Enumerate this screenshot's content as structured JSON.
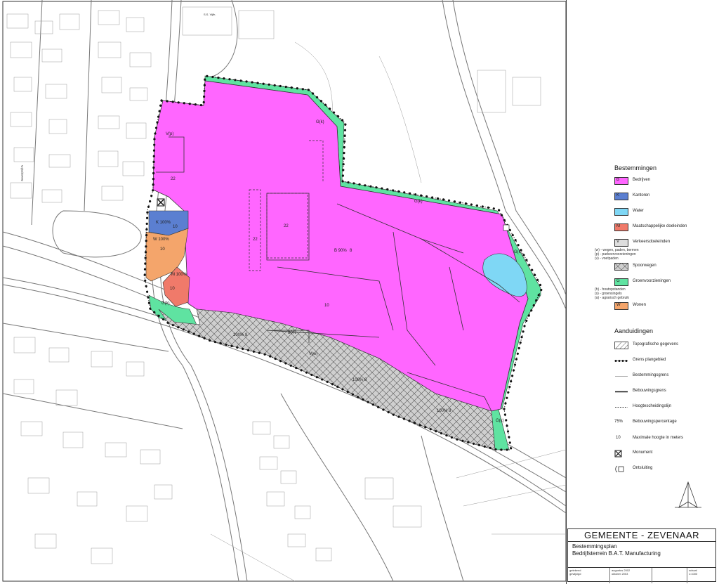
{
  "map": {
    "labels": {
      "gk_top": "G(k)",
      "gk_right": "G(k)",
      "gk_far_right": "G(k)",
      "gk_bottom_right": "G(k)",
      "gk_bottom_left": "G(k)",
      "vp_top_left": "V(p)",
      "height_22_left": "22",
      "height_22_mid1": "22",
      "height_22_mid2": "22",
      "height_10_center": "10",
      "b_90": "B  90%",
      "b_90_height": "8",
      "k_100": "K  100%",
      "k_height": "10",
      "w_100": "W 100%",
      "w_height": "10",
      "m_100": "M 100%",
      "m_height": "10",
      "rail_100_1": "100% 8",
      "rail_80": "80%",
      "rail_vw": "V(w)",
      "rail_100_2": "100% 8",
      "rail_100_3": "100% 8",
      "street_ss": "S.S. Vijfh.",
      "street_vri": "Vrijheidsweg"
    }
  },
  "legend": {
    "bestemmingen_title": "Bestemmingen",
    "items": [
      {
        "code": "B",
        "label": "Bedrijven",
        "color": "#ff66ff"
      },
      {
        "code": "K",
        "label": "Kantoren",
        "color": "#5b7fd1"
      },
      {
        "code": "",
        "label": "Water",
        "color": "#7fd7f5"
      },
      {
        "code": "M",
        "label": "Maatschappelijke doeleinden",
        "color": "#f07a6a"
      },
      {
        "code": "V",
        "label": "Verkeersdoeleinden",
        "color": "#dddddd"
      },
      {
        "code": "SW",
        "label": "Spoorwegen",
        "color": "#bdbdbd"
      },
      {
        "code": "G",
        "label": "Groenvoorzieningen",
        "color": "#5fe3a1"
      },
      {
        "code": "W",
        "label": "Wonen",
        "color": "#f4a56b"
      }
    ],
    "v_sub": [
      "(w) - wegen, paden, bermen",
      "(p) - parkeervoorzieningen",
      "(v) - voetpaden"
    ],
    "g_sub": [
      "(h) - houtopstanden",
      "(s) - groensingels",
      "(a) - agrarisch gebruik"
    ],
    "aanduidingen_title": "Aanduidingen",
    "symbols": [
      {
        "label": "Topografische gegevens",
        "icon": "hatched-box"
      },
      {
        "label": "Grens plangebied",
        "icon": "dotted-line"
      },
      {
        "label": "Bestemmingsgrens",
        "icon": "thin-line"
      },
      {
        "label": "Bebouwingsgrens",
        "icon": "thick-line"
      },
      {
        "label": "Hoogtescheidingslijn",
        "icon": "dashed-line"
      },
      {
        "label": "Bebouwingspercentage",
        "icon": "percentage",
        "sample": "75%"
      },
      {
        "label": "Maximale hoogte in meters",
        "icon": "height",
        "sample": "10"
      },
      {
        "label": "Monument",
        "icon": "monument"
      },
      {
        "label": "Ontsluiting",
        "icon": "access"
      }
    ]
  },
  "title_block": {
    "municipality": "GEMEENTE - ZEVENAAR",
    "plan_type": "Bestemmingsplan",
    "plan_name": "Bedrijfsterrein B.A.T. Manufacturing",
    "meta": {
      "getekend_label": "getekend",
      "getekend_value": "augustus 2002",
      "gewijzigd_label": "gewijzigd",
      "gewijzigd_value": "oktober 2003",
      "scale_label": "schaal",
      "scale_value": "1:1000"
    }
  }
}
